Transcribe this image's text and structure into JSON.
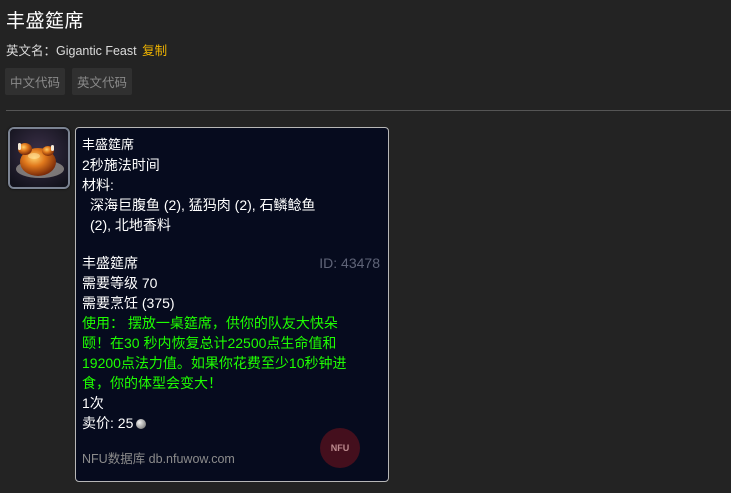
{
  "page": {
    "title": "丰盛筵席",
    "english_name_label": "英文名：",
    "english_name": "Gigantic Feast",
    "copy_label": "复制",
    "buttons": {
      "cn_code": "中文代码",
      "en_code": "英文代码"
    }
  },
  "item_icon": "roasted-turkey-icon",
  "tooltip": {
    "name": "丰盛筵席",
    "cast_time": "2秒施法时间",
    "materials_label": "材料:",
    "materials_line1": "深海巨腹鱼 (2), 猛犸肉 (2), 石鳞鲶鱼",
    "materials_line2": "(2), 北地香料",
    "item_name": "丰盛筵席",
    "id_text": "ID: 43478",
    "req_level": "需要等级 70",
    "req_skill": "需要烹饪 (375)",
    "use_lines": [
      "使用： 摆放一桌筵席，供你的队友大快朵",
      "颐！在30 秒内恢复总计22500点生命值和",
      "19200点法力值。如果你花费至少10秒钟进",
      "食，你的体型会变大！"
    ],
    "charges": "1次",
    "sell_label": "卖价: ",
    "sell_value": "25",
    "coin_icon": "silver-coin-icon",
    "watermark_text": "NFU",
    "footer": "NFU数据库 db.nfuwow.com"
  },
  "colors": {
    "background": "#232323",
    "copy_link": "#f0b400",
    "tooltip_bg": "#060b1e",
    "use_text": "#1eff00",
    "id_text": "#5f6478"
  }
}
